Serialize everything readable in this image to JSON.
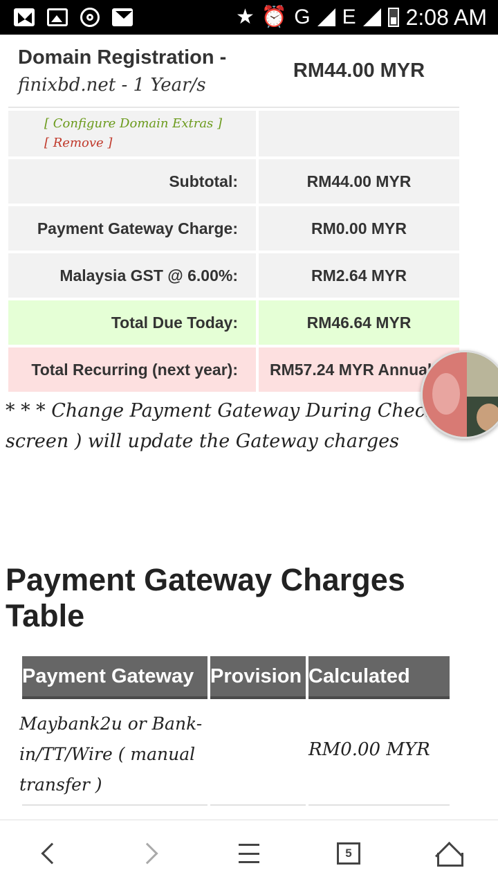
{
  "status_bar": {
    "left_icons": [
      "gmail-icon",
      "gallery-icon",
      "location-target-icon",
      "mail-icon"
    ],
    "right_icons": [
      "star-icon",
      "alarm-icon",
      "signal-g-icon",
      "signal-e-icon",
      "battery-charging-icon"
    ],
    "network_g": "G",
    "network_e": "E",
    "time": "2:08 AM"
  },
  "order": {
    "domain_title": "Domain Registration  -",
    "domain_detail": "finixbd.net - 1 Year/s",
    "domain_price": "RM44.00 MYR",
    "configure_link": "[ Configure Domain Extras ]",
    "remove_link": "[ Remove ]",
    "rows": [
      {
        "label": "Subtotal:",
        "value": "RM44.00 MYR"
      },
      {
        "label": "Payment Gateway Charge:",
        "value": "RM0.00 MYR"
      },
      {
        "label": "Malaysia GST @ 6.00%:",
        "value": "RM2.64 MYR"
      },
      {
        "label": "Total Due Today:",
        "value": "RM46.64 MYR"
      },
      {
        "label": "Total Recurring (next year):",
        "value": "RM57.24 MYR Annual"
      }
    ],
    "colors": {
      "total_due_bg": "#e5ffd6",
      "recurring_bg": "#fde0e0",
      "cell_bg": "#f2f2f2"
    }
  },
  "note": "* * * Change Payment Gateway During Checkout ( screen ) will update the Gateway charges",
  "section_title": "Payment Gateway Charges Table",
  "gateway_table": {
    "headers": [
      "Payment Gateway",
      "Provision",
      "Calculated"
    ],
    "rows": [
      {
        "gateway": "Maybank2u or Bank-in/TT/Wire ( manual transfer )",
        "provision": "",
        "calculated": "RM0.00 MYR"
      }
    ],
    "header_bg": "#666666"
  },
  "bottom_nav": {
    "tab_count": "5",
    "icons": [
      "back-icon",
      "forward-icon",
      "menu-icon",
      "tabs-icon",
      "home-icon"
    ]
  }
}
